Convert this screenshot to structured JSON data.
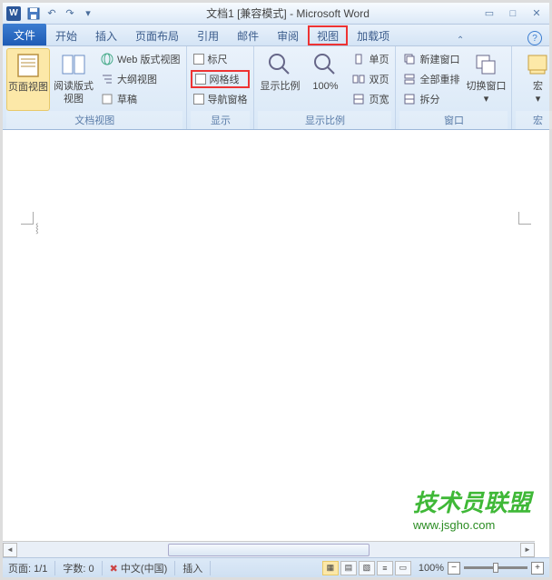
{
  "title": "文档1 [兼容模式] - Microsoft Word",
  "app_icon_letter": "W",
  "tabs": {
    "file": "文件",
    "home": "开始",
    "insert": "插入",
    "layout": "页面布局",
    "references": "引用",
    "mailings": "邮件",
    "review": "审阅",
    "view": "视图",
    "addins": "加载项"
  },
  "ribbon": {
    "views_group": {
      "label": "文档视图",
      "page_view": "页面视图",
      "reading_view_line1": "阅读版式",
      "reading_view_line2": "视图",
      "web_view": "Web 版式视图",
      "outline_view": "大纲视图",
      "draft_view": "草稿"
    },
    "show_group": {
      "label": "显示",
      "ruler": "标尺",
      "gridlines": "网格线",
      "nav_pane": "导航窗格"
    },
    "zoom_group": {
      "label": "显示比例",
      "zoom": "显示比例",
      "hundred": "100%",
      "one_page": "单页",
      "two_pages": "双页",
      "page_width": "页宽"
    },
    "window_group": {
      "label": "窗口",
      "new_window": "新建窗口",
      "arrange_all": "全部重排",
      "split": "拆分",
      "switch_window": "切换窗口"
    },
    "macros_group": {
      "label": "宏",
      "macros": "宏"
    }
  },
  "statusbar": {
    "page": "页面: 1/1",
    "words": "字数: 0",
    "language": "中文(中国)",
    "insert_mode": "插入",
    "zoom_pct": "100%"
  },
  "watermark": {
    "text": "技术员联盟",
    "url": "www.jsgho.com"
  }
}
